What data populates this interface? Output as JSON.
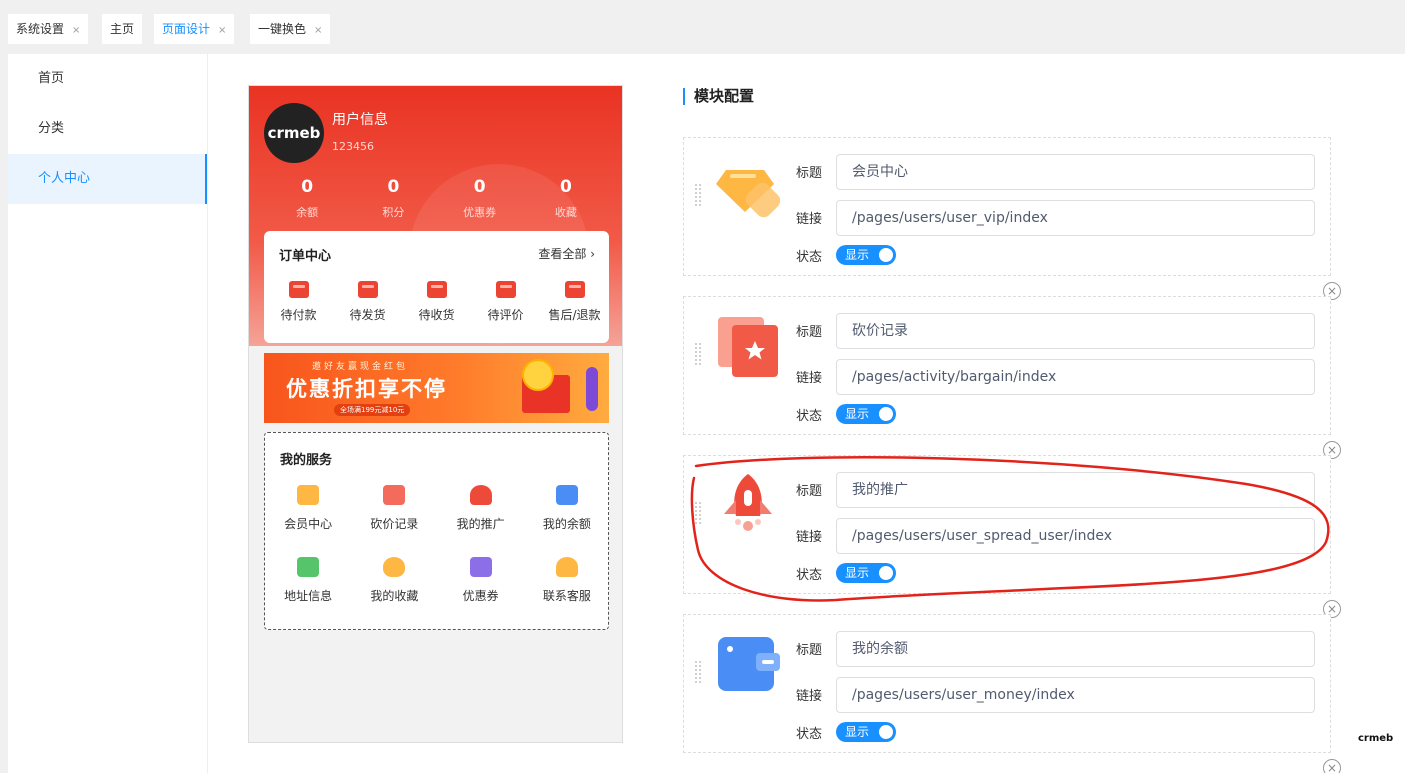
{
  "tabs": [
    {
      "label": "系统设置",
      "closable": true
    },
    {
      "label": "主页",
      "closable": false
    },
    {
      "label": "页面设计",
      "closable": true,
      "active": true
    },
    {
      "label": "一键换色",
      "closable": true
    }
  ],
  "nav": {
    "items": [
      {
        "label": "首页"
      },
      {
        "label": "分类"
      },
      {
        "label": "个人中心",
        "active": true
      }
    ]
  },
  "preview": {
    "avatar_text": "crmeb",
    "user_title": "用户信息",
    "user_id": "123456",
    "stats": [
      {
        "value": "0",
        "label": "余额"
      },
      {
        "value": "0",
        "label": "积分"
      },
      {
        "value": "0",
        "label": "优惠券"
      },
      {
        "value": "0",
        "label": "收藏"
      }
    ],
    "orders": {
      "title": "订单中心",
      "view_all": "查看全部 ›",
      "items": [
        {
          "label": "待付款"
        },
        {
          "label": "待发货"
        },
        {
          "label": "待收货"
        },
        {
          "label": "待评价"
        },
        {
          "label": "售后/退款"
        }
      ]
    },
    "banner": {
      "top": "邀好友赢现金红包",
      "main": "优惠折扣享不停",
      "sub": "全场满199元减10元"
    },
    "services": {
      "title": "我的服务",
      "items": [
        {
          "label": "会员中心",
          "color": "#fdb742"
        },
        {
          "label": "砍价记录",
          "color": "#f46a5b"
        },
        {
          "label": "我的推广",
          "color": "#ee4a3a"
        },
        {
          "label": "我的余额",
          "color": "#4a8ef5"
        },
        {
          "label": "地址信息",
          "color": "#55c46b"
        },
        {
          "label": "我的收藏",
          "color": "#fdb742"
        },
        {
          "label": "优惠券",
          "color": "#8c6ee8"
        },
        {
          "label": "联系客服",
          "color": "#fdb742"
        }
      ]
    }
  },
  "config": {
    "title": "模块配置",
    "field_labels": {
      "title": "标题",
      "link": "链接",
      "status": "状态"
    },
    "modules": [
      {
        "icon": "vip-diamond-icon",
        "title": "会员中心",
        "link": "/pages/users/user_vip/index",
        "status": "显示"
      },
      {
        "icon": "bargain-star-icon",
        "title": "砍价记录",
        "link": "/pages/activity/bargain/index",
        "status": "显示"
      },
      {
        "icon": "rocket-icon",
        "title": "我的推广",
        "link": "/pages/users/user_spread_user/index",
        "status": "显示"
      },
      {
        "icon": "wallet-icon",
        "title": "我的余额",
        "link": "/pages/users/user_money/index",
        "status": "显示"
      }
    ]
  },
  "brand_mark": "crmeb",
  "colors": {
    "accent": "#1890ff",
    "brand_red": "#e93323"
  }
}
